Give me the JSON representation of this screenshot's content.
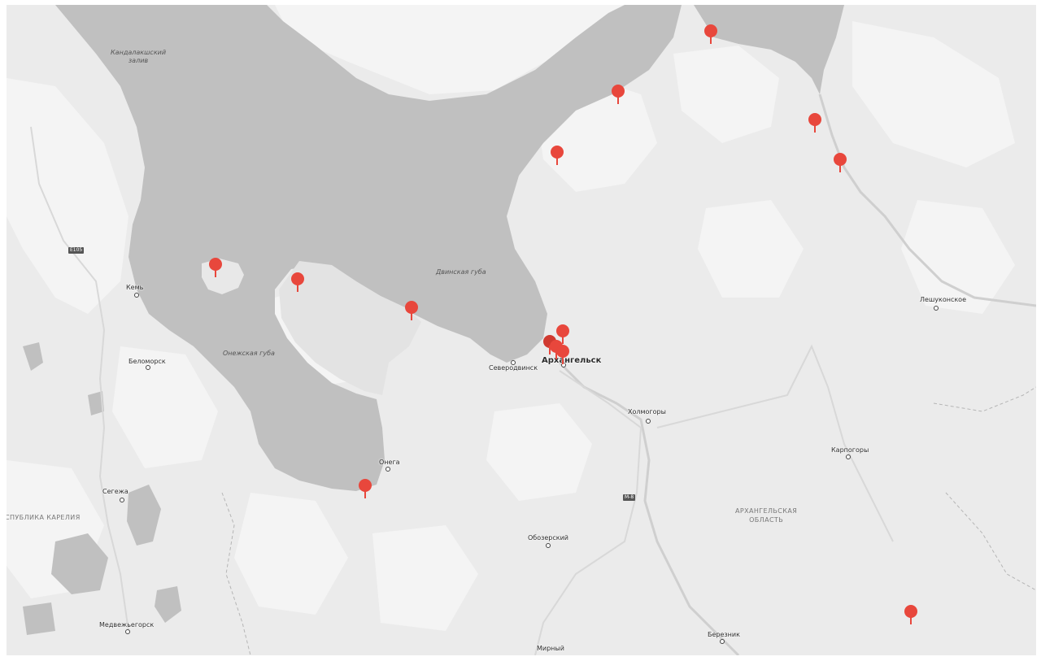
{
  "map": {
    "water_labels": {
      "kandalaksha": "Кандалакшский\nзалив",
      "dvina": "Двинская губа",
      "onega": "Онежская губа"
    },
    "region_labels": {
      "arkhangelsk_oblast": "АРХАНГЕЛЬСКАЯ\nОБЛАСТЬ",
      "karelia": "СПУБЛИКА КАРЕЛИЯ"
    },
    "road_shields": {
      "e105": "E105",
      "m8": "М-8"
    },
    "cities": {
      "arkhangelsk": "Архангельск",
      "severodvinsk": "Северодвинск",
      "kem": "Кемь",
      "belomorsk": "Беломорск",
      "onega": "Онега",
      "segezha": "Сегежа",
      "medvezhyegorsk": "Медвежьегорск",
      "obozersky": "Обозерский",
      "mirny": "Мирный",
      "bereznik": "Березник",
      "kholmogory": "Холмогоры",
      "karpogory": "Карпогоры",
      "leshukonskoye": "Лешуконское"
    },
    "marker_color": "#e8473c",
    "water_color": "#c0c0c0",
    "land_color": "#ebebeb"
  }
}
